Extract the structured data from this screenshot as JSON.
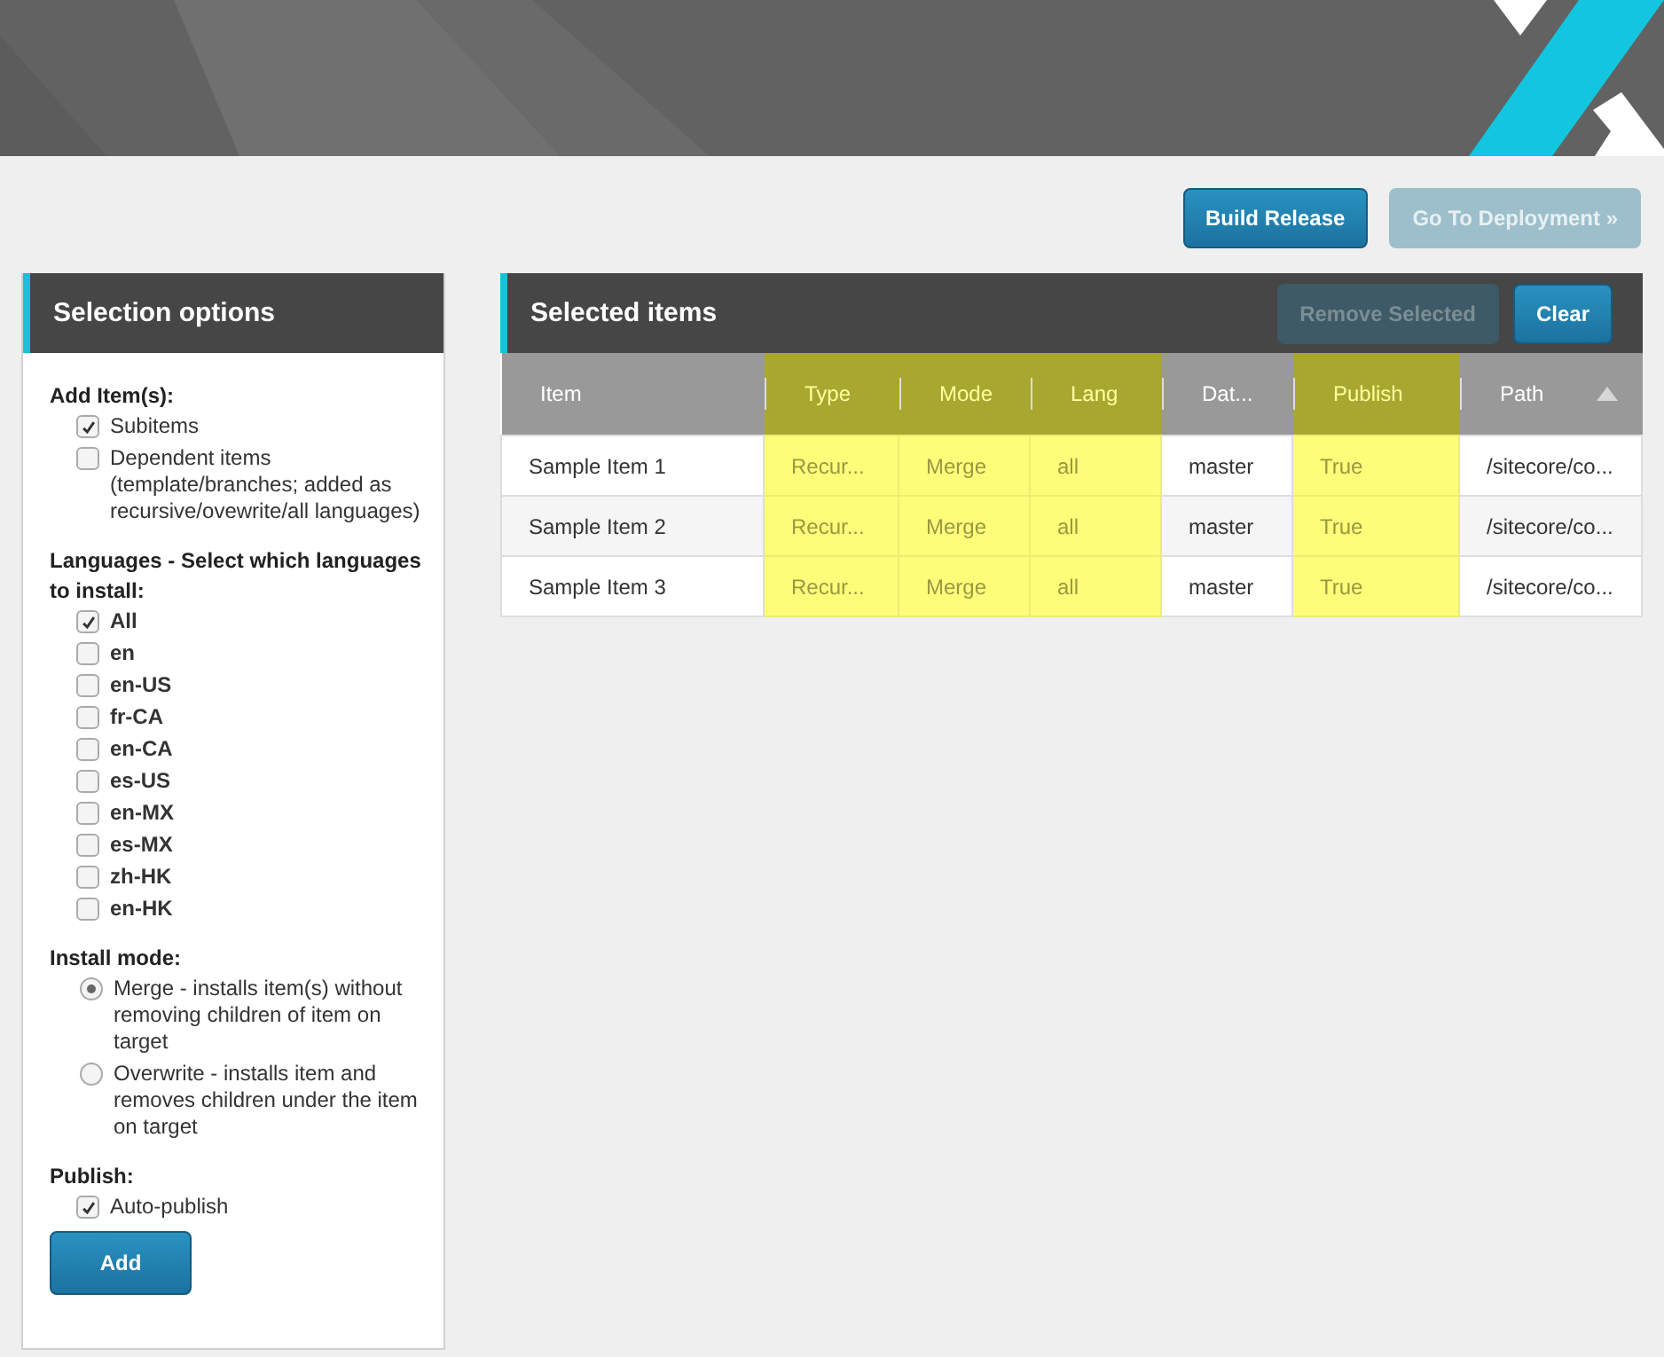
{
  "toolbar": {
    "buttons": [
      {
        "label": "Build Release",
        "disabled": false
      },
      {
        "label": "Go To Deployment »",
        "disabled": true
      }
    ]
  },
  "selection_options": {
    "title": "Selection options",
    "groups": [
      {
        "label": "Add Item(s):",
        "kind": "checkbox",
        "bold_options": false,
        "options": [
          {
            "label": "Subitems",
            "checked": true
          },
          {
            "label": "Dependent items (template/branches; added as recursive/ovewrite/all languages)",
            "checked": false
          }
        ]
      },
      {
        "label": "Languages - Select which languages to install:",
        "kind": "checkbox",
        "bold_options": true,
        "options": [
          {
            "label": "All",
            "checked": true
          },
          {
            "label": "en",
            "checked": false
          },
          {
            "label": "en-US",
            "checked": false
          },
          {
            "label": "fr-CA",
            "checked": false
          },
          {
            "label": "en-CA",
            "checked": false
          },
          {
            "label": "es-US",
            "checked": false
          },
          {
            "label": "en-MX",
            "checked": false
          },
          {
            "label": "es-MX",
            "checked": false
          },
          {
            "label": "zh-HK",
            "checked": false
          },
          {
            "label": "en-HK",
            "checked": false
          }
        ]
      },
      {
        "label": "Install mode:",
        "kind": "radio",
        "bold_options": false,
        "options": [
          {
            "label": "Merge - installs item(s) without removing children of item on target",
            "selected": true
          },
          {
            "label": "Overwrite - installs item and removes children under the item on target",
            "selected": false
          }
        ]
      },
      {
        "label": "Publish:",
        "kind": "checkbox",
        "bold_options": false,
        "options": [
          {
            "label": "Auto-publish",
            "checked": true
          }
        ]
      }
    ],
    "add_button": "Add"
  },
  "selected_items": {
    "title": "Selected items",
    "buttons": [
      {
        "label": "Remove Selected",
        "disabled": true
      },
      {
        "label": "Clear",
        "disabled": false
      }
    ],
    "columns": [
      {
        "label": "Item",
        "highlighted": false,
        "sorted": false
      },
      {
        "label": "Type",
        "highlighted": true,
        "sorted": false
      },
      {
        "label": "Mode",
        "highlighted": true,
        "sorted": false
      },
      {
        "label": "Lang",
        "highlighted": true,
        "sorted": false
      },
      {
        "label": "Dat...",
        "highlighted": false,
        "sorted": false
      },
      {
        "label": "Publish",
        "highlighted": true,
        "sorted": false
      },
      {
        "label": "Path",
        "highlighted": false,
        "sorted": true
      }
    ],
    "rows": [
      [
        "Sample Item 1",
        "Recur...",
        "Merge",
        "all",
        "master",
        "True",
        "/sitecore/co..."
      ],
      [
        "Sample Item 2",
        "Recur...",
        "Merge",
        "all",
        "master",
        "True",
        "/sitecore/co..."
      ],
      [
        "Sample Item 3",
        "Recur...",
        "Merge",
        "all",
        "master",
        "True",
        "/sitecore/co..."
      ]
    ]
  }
}
